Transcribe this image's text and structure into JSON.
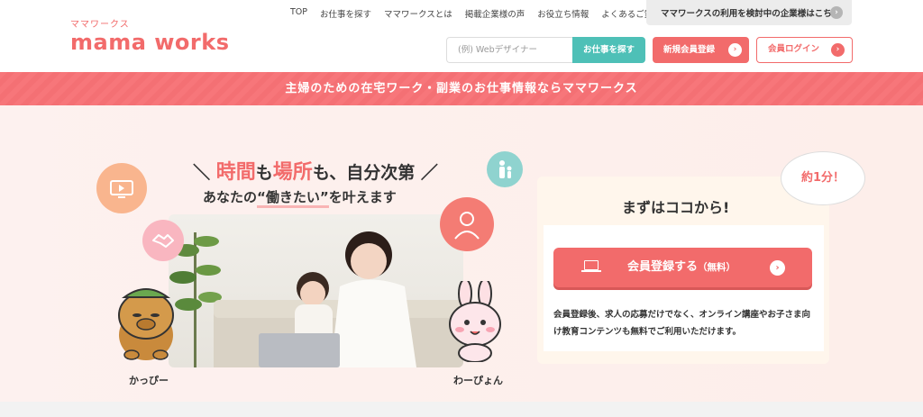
{
  "header": {
    "logo_kana": "ママワークス",
    "logo_main": "mama works",
    "nav": [
      "TOP",
      "お仕事を探す",
      "ママワークスとは",
      "掲載企業様の声",
      "お役立ち情報",
      "よくあるご質問"
    ],
    "corp_link": "ママワークスの利用を検討中の企業様はこちら",
    "search_placeholder": "(例) Webデザイナー",
    "search_button": "お仕事を探す",
    "signup_button": "新規会員登録",
    "login_button": "会員ログイン"
  },
  "banner": {
    "text": "主婦のための在宅ワーク・副業のお仕事情報ならママワークス"
  },
  "hero": {
    "headline_prefix": "＼ ",
    "headline_word1": "時間",
    "headline_mid1": "も",
    "headline_word2": "場所",
    "headline_mid2": "も、自分次第 ／",
    "sub_prefix": "あなたの",
    "sub_highlight": "“働きたい”",
    "sub_suffix": "を叶えます",
    "char_left": "かっぴー",
    "char_right": "わーぴょん"
  },
  "card": {
    "bubble": "約1分！",
    "title": "まずはココから!",
    "register_main": "会員登録する",
    "register_sub": "（無料）",
    "description": "会員登録後、求人の応募だけでなく、オンライン講座やお子さま向け教育コンテンツも無料でご利用いただけます。"
  },
  "colors": {
    "accent": "#f26b6b",
    "teal": "#4ec0b7",
    "hero_bg": "#fdf1ef"
  },
  "icons": [
    "monitor-icon",
    "handshake-icon",
    "family-icon",
    "person-icon",
    "laptop-icon",
    "arrow-right-icon"
  ]
}
